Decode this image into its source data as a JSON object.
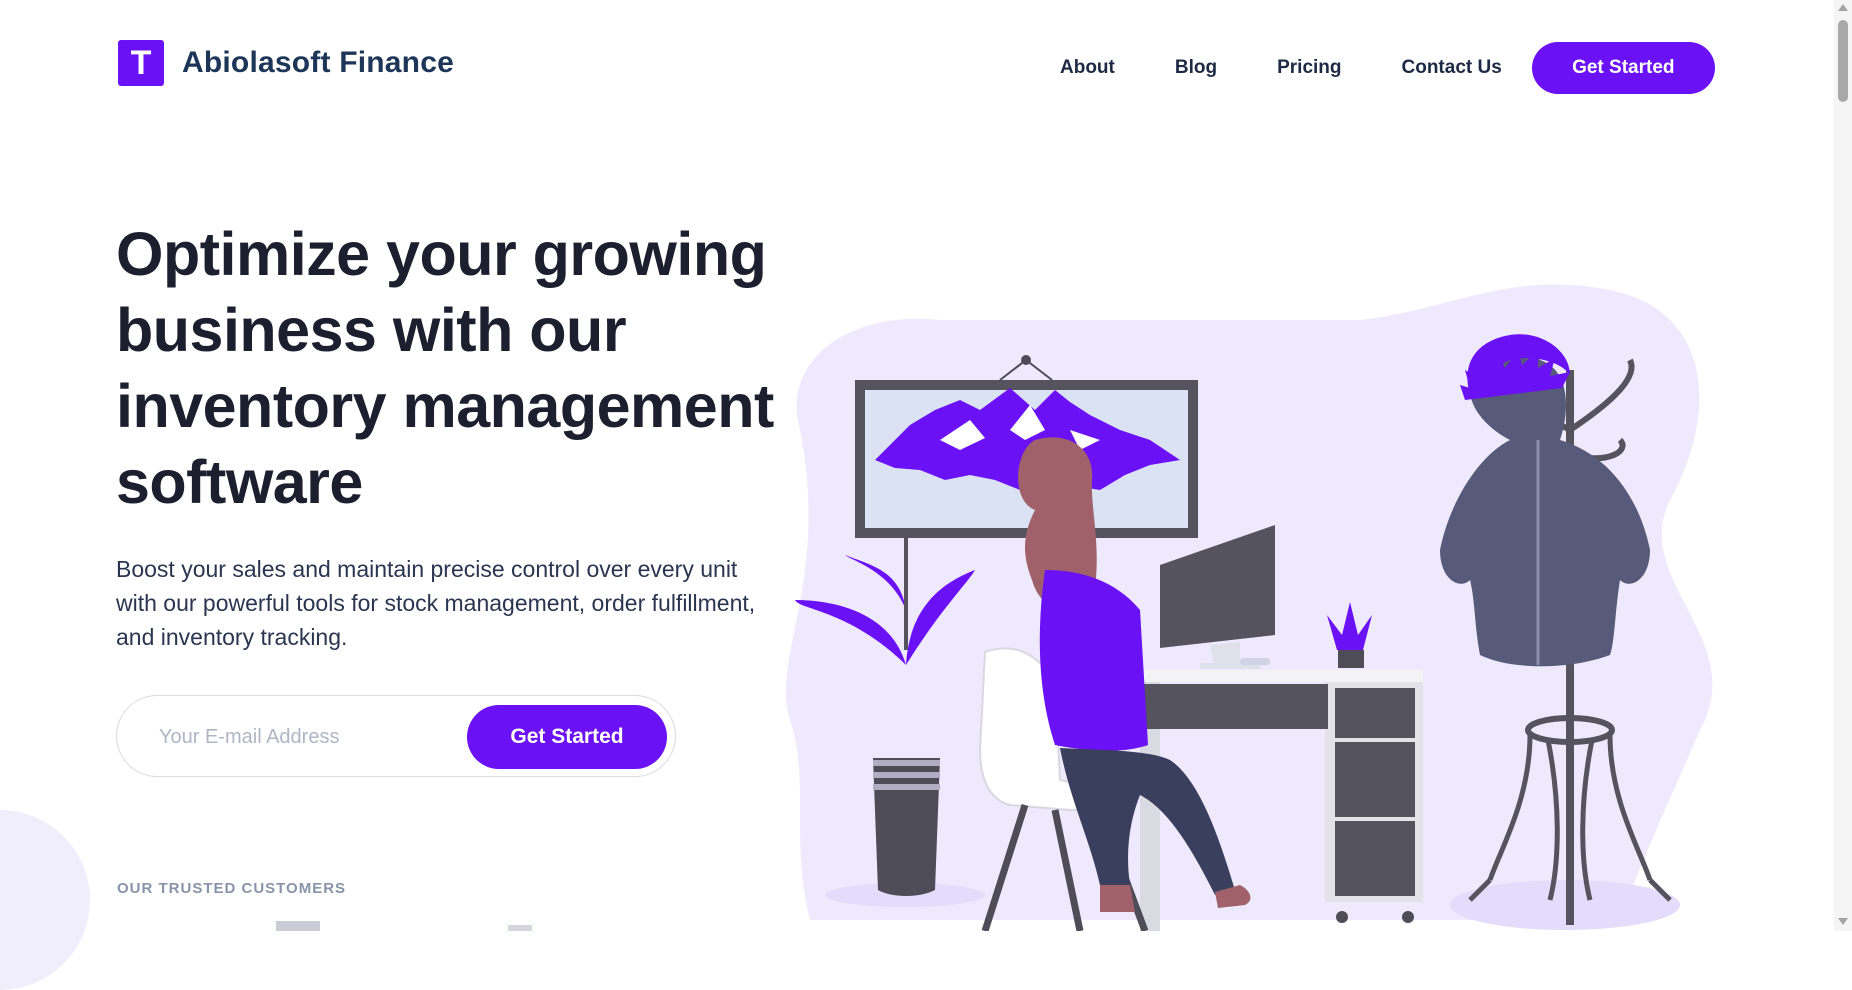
{
  "brand": {
    "logo_letter": "T",
    "name": "Abiolasoft Finance",
    "accent": "#6a11f5"
  },
  "nav": {
    "items": [
      {
        "label": "About"
      },
      {
        "label": "Blog"
      },
      {
        "label": "Pricing"
      },
      {
        "label": "Contact Us"
      }
    ],
    "cta_label": "Get Started"
  },
  "hero": {
    "title": "Optimize your growing business with our inventory management software",
    "subtitle": "Boost your sales and maintain precise control over every unit with our powerful tools for stock management, order fulfillment, and inventory tracking.",
    "email_placeholder": "Your E-mail Address",
    "cta_label": "Get Started"
  },
  "trusted": {
    "label": "OUR TRUSTED CUSTOMERS"
  },
  "illustration": {
    "icon": "office-worker-illustration"
  }
}
